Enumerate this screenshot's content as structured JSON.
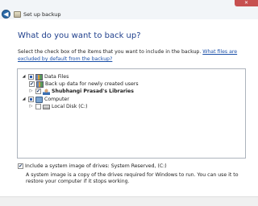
{
  "window": {
    "title": "Set up backup",
    "close_glyph": "✕",
    "back_glyph": "◀"
  },
  "main": {
    "heading": "What do you want to back up?",
    "instructions": "Select the check box of the items that you want to include in the backup. ",
    "excluded_link": "What files are excluded by default from the backup?"
  },
  "tree": {
    "data_files": {
      "label": "Data Files",
      "expander": "◢",
      "check": "partial"
    },
    "new_users": {
      "label": "Back up data for newly created users",
      "check": "✔"
    },
    "user_libraries": {
      "label": "Shubhangi Prasad's Libraries",
      "expander": "▷",
      "check": "✔"
    },
    "computer": {
      "label": "Computer",
      "expander": "◢",
      "check": "partial"
    },
    "local_disk": {
      "label": "Local Disk (C:)",
      "expander": "▷",
      "check": ""
    }
  },
  "system_image": {
    "label": "Include a system image of drives: System Reserved, (C:)",
    "check": "✔",
    "description": "A system image is a copy of the drives required for Windows to run. You can use it to restore your computer if it stops working."
  }
}
